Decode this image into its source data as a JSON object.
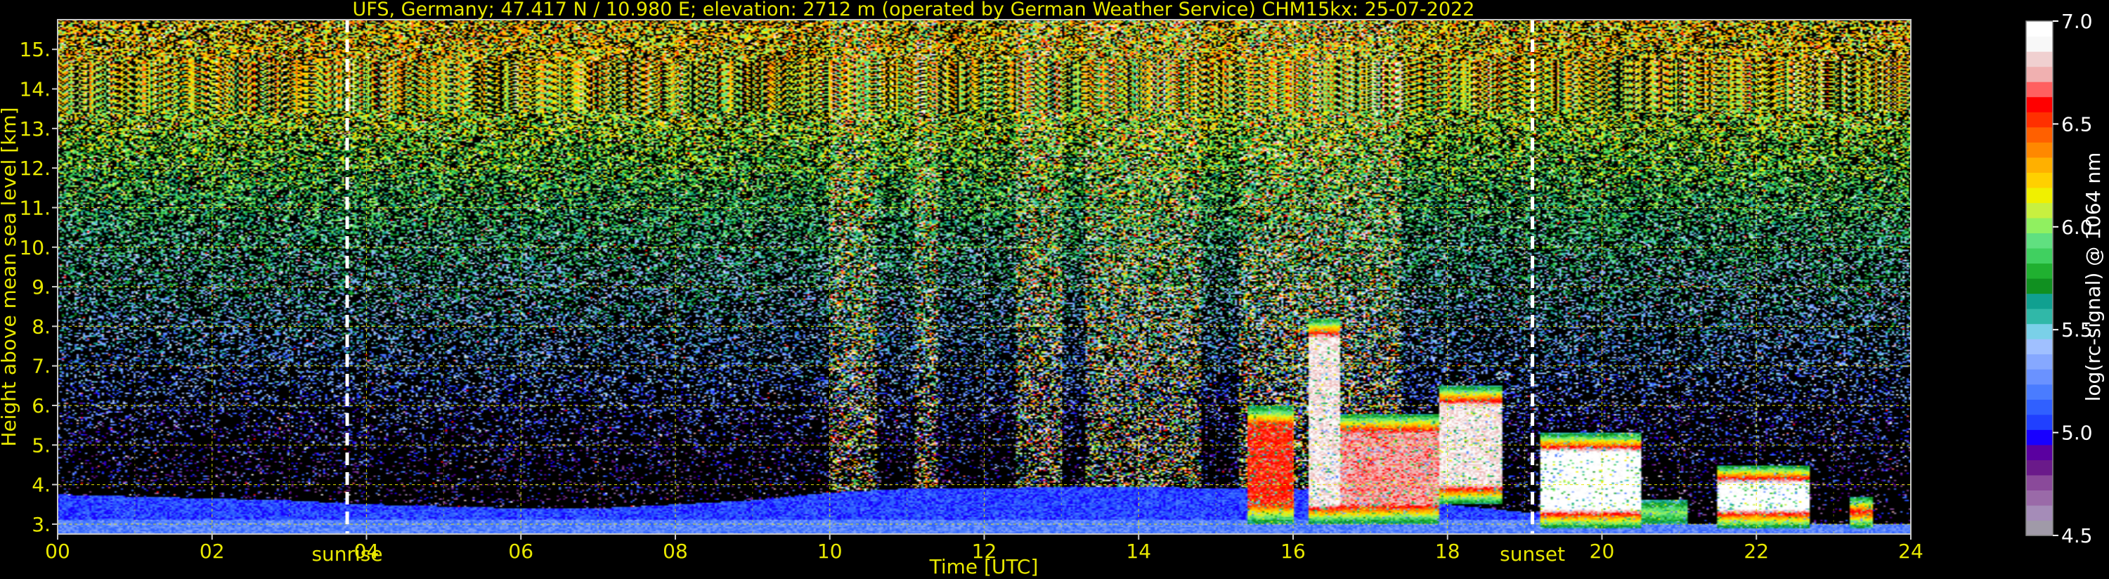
{
  "chart_data": {
    "type": "heatmap",
    "title": "UFS, Germany; 47.417 N / 10.980 E; elevation: 2712 m  (operated by German Weather Service)    CHM15kx: 25-07-2022",
    "xlabel": "Time [UTC]",
    "ylabel": "Height above mean sea level [km]",
    "xlim": [
      0,
      24
    ],
    "ylim": [
      2.75,
      15.75
    ],
    "x_ticks": [
      0,
      2,
      4,
      6,
      8,
      10,
      12,
      14,
      16,
      18,
      20,
      22,
      24
    ],
    "x_tick_labels": [
      "00",
      "02",
      "04",
      "06",
      "08",
      "10",
      "12",
      "14",
      "16",
      "18",
      "20",
      "22",
      "24"
    ],
    "y_ticks": [
      3,
      4,
      5,
      6,
      7,
      8,
      9,
      10,
      11,
      12,
      13,
      14,
      15
    ],
    "y_tick_labels": [
      "3.",
      "4.",
      "5.",
      "6.",
      "7.",
      "8.",
      "9.",
      "10.",
      "11.",
      "12.",
      "13.",
      "14.",
      "15."
    ],
    "grid": true,
    "annotations": [
      {
        "label": "sunrise",
        "x": 3.75
      },
      {
        "label": "sunset",
        "x": 19.1
      }
    ],
    "colorbar": {
      "label": "log(rc-signal) @ 1064 nm",
      "range": [
        4.5,
        7.0
      ],
      "ticks": [
        4.5,
        5.0,
        5.5,
        6.0,
        6.5,
        7.0
      ],
      "tick_labels": [
        "4.5",
        "5.0",
        "5.5",
        "6.0",
        "6.5",
        "7.0"
      ],
      "colors": [
        "#a09aa8",
        "#a58cb8",
        "#9a6aa8",
        "#8a4a9a",
        "#6a1a8a",
        "#5a00a0",
        "#1800ff",
        "#2040ff",
        "#3060ff",
        "#4a7cff",
        "#6a92ff",
        "#86a8ff",
        "#a0c0ff",
        "#7ad0e8",
        "#30b8a8",
        "#10a090",
        "#109020",
        "#20b030",
        "#40d060",
        "#60e080",
        "#90f060",
        "#c8f040",
        "#f0f000",
        "#ffd000",
        "#ffb000",
        "#ff8800",
        "#ff6000",
        "#ff3000",
        "#ff0000",
        "#ff6060",
        "#f0b0b0",
        "#f0d0d0",
        "#f8f8f8",
        "#ffffff"
      ]
    },
    "boundary_layer_top_km": [
      [
        0,
        3.75
      ],
      [
        1,
        3.7
      ],
      [
        2,
        3.65
      ],
      [
        3,
        3.6
      ],
      [
        4,
        3.5
      ],
      [
        5,
        3.45
      ],
      [
        6,
        3.4
      ],
      [
        7,
        3.4
      ],
      [
        8,
        3.5
      ],
      [
        9,
        3.6
      ],
      [
        10,
        3.8
      ],
      [
        11,
        3.9
      ],
      [
        12,
        3.9
      ],
      [
        13,
        3.95
      ],
      [
        14,
        3.95
      ],
      [
        15,
        3.9
      ],
      [
        16,
        3.9
      ],
      [
        17,
        3.7
      ],
      [
        18,
        3.5
      ],
      [
        19,
        3.3
      ],
      [
        20,
        3.2
      ],
      [
        21,
        3.0
      ],
      [
        22,
        3.0
      ],
      [
        23,
        3.0
      ],
      [
        24,
        3.0
      ]
    ],
    "cloud_layers": [
      {
        "t_start": 15.4,
        "t_end": 16.0,
        "base_km": 3.0,
        "top_km": 6.0,
        "intensity": 0.7
      },
      {
        "t_start": 16.2,
        "t_end": 16.6,
        "base_km": 3.0,
        "top_km": 8.2,
        "intensity": 0.9
      },
      {
        "t_start": 16.6,
        "t_end": 17.9,
        "base_km": 3.0,
        "top_km": 5.8,
        "intensity": 0.8
      },
      {
        "t_start": 17.9,
        "t_end": 18.7,
        "base_km": 3.5,
        "top_km": 6.5,
        "intensity": 0.9
      },
      {
        "t_start": 19.2,
        "t_end": 20.5,
        "base_km": 2.9,
        "top_km": 5.3,
        "intensity": 1.0
      },
      {
        "t_start": 20.5,
        "t_end": 21.1,
        "base_km": 3.0,
        "top_km": 3.6,
        "intensity": 0.5
      },
      {
        "t_start": 21.5,
        "t_end": 22.7,
        "base_km": 2.9,
        "top_km": 4.5,
        "intensity": 1.0
      },
      {
        "t_start": 23.2,
        "t_end": 23.5,
        "base_km": 2.9,
        "top_km": 3.7,
        "intensity": 0.9
      }
    ],
    "precip_streaks": [
      {
        "t_start": 10.0,
        "t_end": 10.6
      },
      {
        "t_start": 11.1,
        "t_end": 11.4
      },
      {
        "t_start": 12.4,
        "t_end": 13.0
      },
      {
        "t_start": 13.3,
        "t_end": 14.8
      },
      {
        "t_start": 15.3,
        "t_end": 16.0
      },
      {
        "t_start": 16.0,
        "t_end": 17.4
      }
    ]
  }
}
